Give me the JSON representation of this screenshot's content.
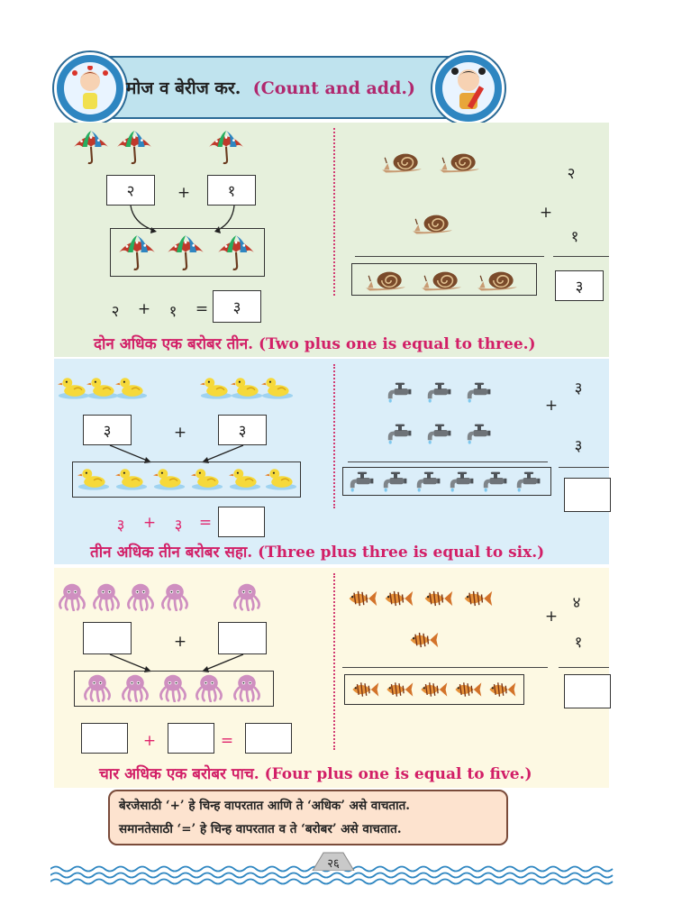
{
  "header": {
    "title_mr": "मोज व बेरीज कर.",
    "title_en": "(Count and add.)"
  },
  "section1": {
    "left": {
      "box_a": "२",
      "plus": "+",
      "box_b": "१",
      "eq_a": "२",
      "eq_plus": "+",
      "eq_b": "१",
      "eq_equals": "=",
      "eq_result": "३"
    },
    "right": {
      "top_num": "२",
      "plus": "+",
      "bottom_num": "१",
      "result": "३"
    },
    "sentence": "दोन अधिक एक बरोबर तीन. (Two plus one is equal to three.)"
  },
  "section2": {
    "left": {
      "box_a": "३",
      "plus": "+",
      "box_b": "३",
      "eq_a": "३",
      "eq_plus": "+",
      "eq_b": "३",
      "eq_equals": "="
    },
    "right": {
      "top_num": "३",
      "plus": "+",
      "bottom_num": "३"
    },
    "sentence": "तीन अधिक तीन बरोबर सहा. (Three plus three is equal to six.)"
  },
  "section3": {
    "left": {
      "plus": "+",
      "eq_plus": "+",
      "eq_equals": "="
    },
    "right": {
      "top_num": "४",
      "plus": "+",
      "bottom_num": "१"
    },
    "sentence": "चार अधिक एक बरोबर पाच. (Four plus one is equal to five.)"
  },
  "note": {
    "line1": "बेरजेसाठी ‘+’ हे चिन्ह वापरतात आणि ते ‘अधिक’ असे वाचतात.",
    "line2": "समानतेसाठी ‘=’ हे चिन्ह वापरतात व ते ‘बरोबर’ असे वाचतात."
  },
  "page_number": "२६",
  "icons": {
    "umbrella": "umbrella-icon",
    "snail": "snail-icon",
    "duck": "duck-icon",
    "tap": "tap-icon",
    "octopus": "octopus-icon",
    "fish": "fish-icon"
  }
}
